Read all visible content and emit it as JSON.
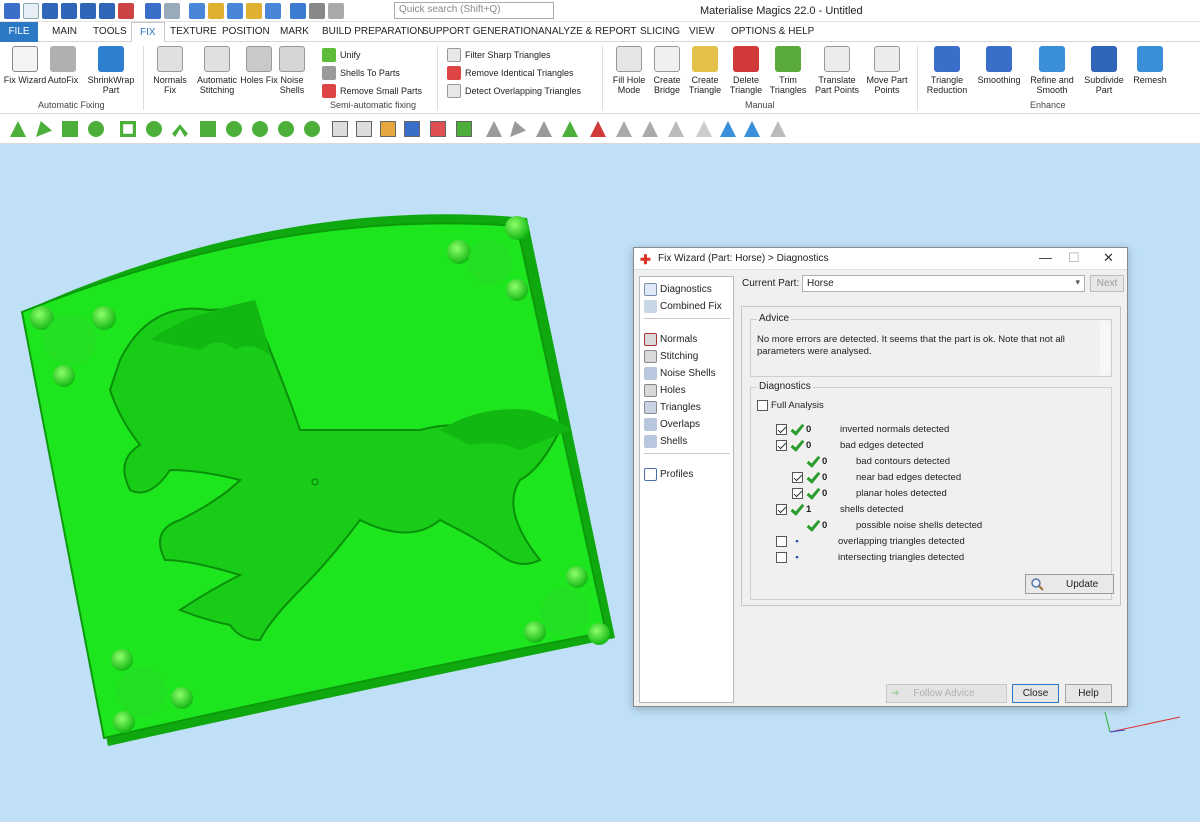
{
  "app": {
    "title": "Materialise Magics 22.0 - Untitled",
    "search_placeholder": "Quick search (Shift+Q)"
  },
  "tabs": [
    "FILE",
    "MAIN",
    "TOOLS",
    "FIX",
    "TEXTURE",
    "POSITION",
    "MARK",
    "BUILD PREPARATION",
    "SUPPORT GENERATION",
    "ANALYZE & REPORT",
    "SLICING",
    "VIEW",
    "OPTIONS & HELP"
  ],
  "active_tab": "FIX",
  "ribbon": {
    "automatic_fixing": {
      "label": "Automatic Fixing",
      "buttons": [
        "Fix Wizard",
        "AutoFix",
        "ShrinkWrap Part"
      ]
    },
    "semi_automatic": {
      "label": "Semi-automatic fixing",
      "buttons": [
        "Normals Fix",
        "Automatic Stitching",
        "Holes Fix",
        "Noise Shells"
      ],
      "small": [
        "Unify",
        "Shells To Parts",
        "Remove Small Parts"
      ]
    },
    "triangle_tools": [
      "Filter Sharp Triangles",
      "Remove Identical Triangles",
      "Detect Overlapping Triangles"
    ],
    "manual": {
      "label": "Manual",
      "buttons": [
        "Fill Hole Mode",
        "Create Bridge",
        "Create Triangle",
        "Delete Triangle",
        "Trim Triangles",
        "Translate Part Points",
        "Move Part Points"
      ]
    },
    "enhance": {
      "label": "Enhance",
      "buttons": [
        "Triangle Reduction",
        "Smoothing",
        "Refine and Smooth",
        "Subdivide Part",
        "Remesh"
      ]
    }
  },
  "colors": {
    "part_green": "#1ee61e",
    "viewport_bg": "#bfe0f7",
    "file_tab_blue": "#2b78c5",
    "check_green": "#2a9d2a"
  },
  "dialog": {
    "title": "Fix Wizard (Part: Horse) > Diagnostics",
    "nav_top": [
      "Diagnostics",
      "Combined Fix"
    ],
    "nav_mid": [
      "Normals",
      "Stitching",
      "Noise Shells",
      "Holes",
      "Triangles",
      "Overlaps",
      "Shells"
    ],
    "nav_bottom": [
      "Profiles"
    ],
    "current_part_label": "Current Part:",
    "current_part_value": "Horse",
    "next_label": "Next",
    "advice_label": "Advice",
    "advice_text": "No more errors are detected. It seems that the part is ok. Note that not all parameters were analysed.",
    "diagnostics_label": "Diagnostics",
    "full_analysis_label": "Full Analysis",
    "full_analysis_checked": false,
    "items": [
      {
        "checked": true,
        "status": "ok",
        "count": "0",
        "label": "inverted normals detected",
        "indent": 0
      },
      {
        "checked": true,
        "status": "ok",
        "count": "0",
        "label": "bad edges detected",
        "indent": 0
      },
      {
        "checked": null,
        "status": "ok",
        "count": "0",
        "label": "bad contours detected",
        "indent": 1
      },
      {
        "checked": true,
        "status": "ok",
        "count": "0",
        "label": "near bad edges detected",
        "indent": 1
      },
      {
        "checked": true,
        "status": "ok",
        "count": "0",
        "label": "planar holes detected",
        "indent": 1
      },
      {
        "checked": true,
        "status": "ok",
        "count": "1",
        "label": "shells detected",
        "indent": 0
      },
      {
        "checked": null,
        "status": "ok",
        "count": "0",
        "label": "possible noise shells detected",
        "indent": 1
      },
      {
        "checked": false,
        "status": "unknown",
        "count": "",
        "label": "overlapping triangles detected",
        "indent": 0
      },
      {
        "checked": false,
        "status": "unknown",
        "count": "",
        "label": "intersecting triangles detected",
        "indent": 0
      }
    ],
    "update_label": "Update",
    "follow_advice_label": "Follow Advice",
    "close_label": "Close",
    "help_label": "Help"
  }
}
